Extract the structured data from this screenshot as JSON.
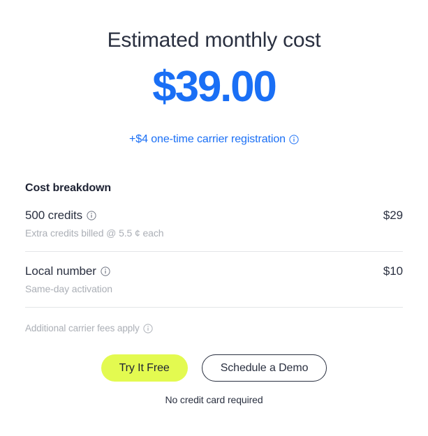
{
  "hero": {
    "title": "Estimated monthly cost",
    "price": "$39.00",
    "note": "+$4 one-time carrier registration",
    "note_info_icon": "info-icon",
    "accent_color": "#1a6ff5",
    "title_color": "#2a3040"
  },
  "breakdown": {
    "heading": "Cost breakdown",
    "items": [
      {
        "label": "500 credits",
        "info_icon": "info-icon",
        "sublabel": "Extra credits billed @ 5.5 ¢ each",
        "price": "$29"
      },
      {
        "label": "Local number",
        "info_icon": "info-icon",
        "sublabel": "Same-day activation",
        "price": "$10"
      }
    ],
    "footnote": "Additional carrier fees apply",
    "footnote_info_icon": "info-icon"
  },
  "cta": {
    "primary_label": "Try It Free",
    "primary_color": "#e3fa50",
    "secondary_label": "Schedule a Demo",
    "caption": "No credit card required"
  }
}
